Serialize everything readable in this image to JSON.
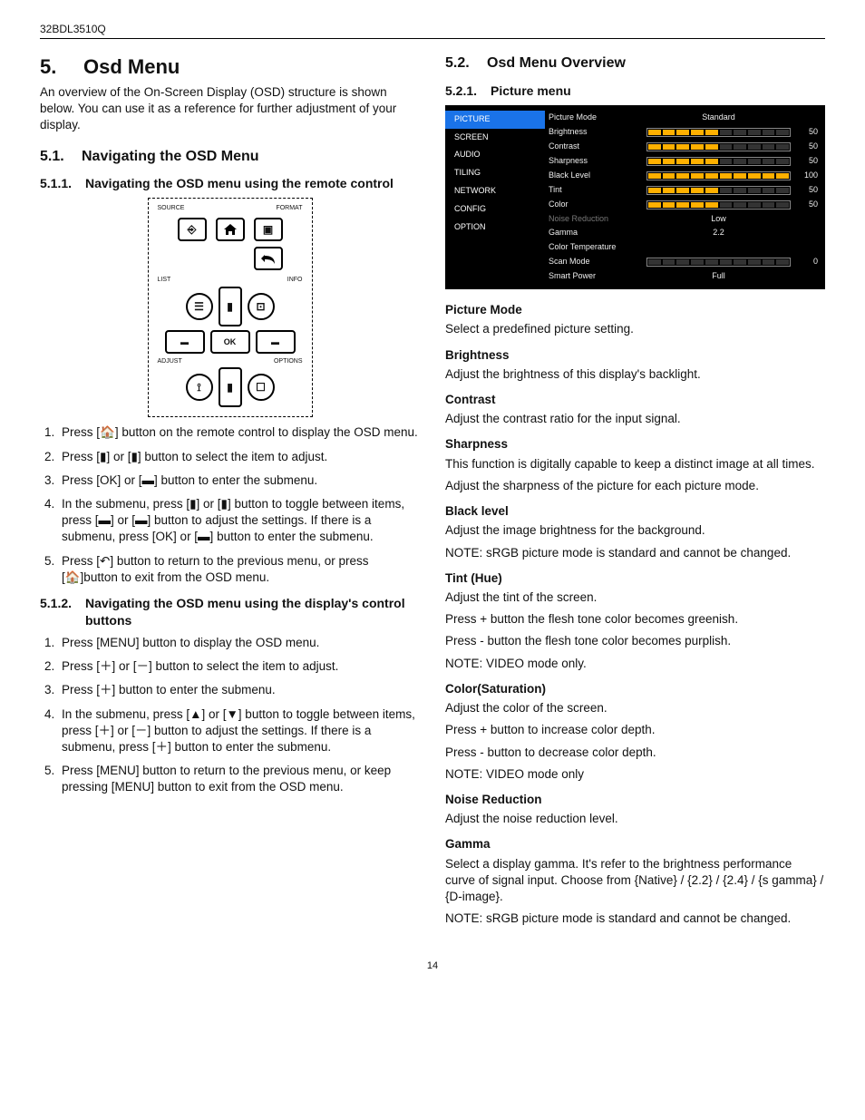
{
  "header": {
    "model": "32BDL3510Q"
  },
  "page_number": "14",
  "col1": {
    "h5_num": "5.",
    "h5_title": "Osd Menu",
    "intro": "An overview of the On-Screen Display (OSD) structure is shown below. You can use it as a reference for further adjustment of your display.",
    "h51_num": "5.1.",
    "h51_title": "Navigating the OSD Menu",
    "h511_num": "5.1.1.",
    "h511_title": "Navigating the OSD menu using the remote control",
    "remote_labels": {
      "source": "SOURCE",
      "format": "FORMAT",
      "list": "LIST",
      "info": "INFO",
      "adjust": "ADJUST",
      "options": "OPTIONS",
      "ok": "OK"
    },
    "steps_remote": [
      "Press [🏠] button on the remote control to display the OSD menu.",
      "Press [▮] or [▮] button to select the item to adjust.",
      "Press [OK] or [▬] button to enter the submenu.",
      "In the submenu, press [▮] or [▮] button to toggle between items, press [▬] or [▬] button to adjust the settings. If there is a submenu, press [OK] or [▬] button to enter the submenu.",
      "Press [↶] button to return to the previous menu, or press [🏠]button to exit from the OSD menu."
    ],
    "h512_num": "5.1.2.",
    "h512_title": "Navigating the OSD menu using the display's control buttons",
    "steps_display": [
      "Press [MENU] button to display the OSD menu.",
      "Press [＋] or [－] button to select the item to adjust.",
      "Press [＋] button to enter the submenu.",
      "In the submenu, press [▲] or [▼] button to toggle between items, press [＋] or [－] button to adjust the settings. If there is a submenu, press [＋] button to enter the submenu.",
      "Press [MENU] button to return to the previous menu, or keep pressing [MENU] button to exit from the OSD menu."
    ]
  },
  "col2": {
    "h52_num": "5.2.",
    "h52_title": "Osd Menu Overview",
    "h521_num": "5.2.1.",
    "h521_title": "Picture menu",
    "osd": {
      "nav": [
        "PICTURE",
        "SCREEN",
        "AUDIO",
        "TILING",
        "NETWORK",
        "CONFIG",
        "OPTION"
      ],
      "selected_index": 0,
      "rows": [
        {
          "label": "Picture Mode",
          "type": "text",
          "value": "Standard"
        },
        {
          "label": "Brightness",
          "type": "slider",
          "level": 5,
          "num": "50"
        },
        {
          "label": "Contrast",
          "type": "slider",
          "level": 5,
          "num": "50"
        },
        {
          "label": "Sharpness",
          "type": "slider",
          "level": 5,
          "num": "50"
        },
        {
          "label": "Black Level",
          "type": "slider",
          "level": 10,
          "num": "100"
        },
        {
          "label": "Tint",
          "type": "slider",
          "level": 5,
          "num": "50"
        },
        {
          "label": "Color",
          "type": "slider",
          "level": 5,
          "num": "50"
        },
        {
          "label": "Noise Reduction",
          "type": "text",
          "value": "Low",
          "dim": true
        },
        {
          "label": "Gamma",
          "type": "text",
          "value": "2.2"
        },
        {
          "label": "Color Temperature",
          "type": "text",
          "value": ""
        },
        {
          "label": "Scan Mode",
          "type": "slider",
          "level": 0,
          "num": "0"
        },
        {
          "label": "Smart Power",
          "type": "text",
          "value": "Full"
        }
      ]
    },
    "desc": [
      {
        "h": "Picture Mode",
        "p": [
          "Select a predefined picture setting."
        ]
      },
      {
        "h": "Brightness",
        "p": [
          "Adjust the brightness of this display's backlight."
        ]
      },
      {
        "h": "Contrast",
        "p": [
          " Adjust the contrast ratio for the input signal."
        ]
      },
      {
        "h": "Sharpness",
        "p": [
          "This function is digitally capable to keep a distinct image at all times.",
          "Adjust the sharpness of the picture for each picture mode."
        ]
      },
      {
        "h": "Black level",
        "p": [
          "Adjust the image brightness for the background.",
          "NOTE: sRGB picture mode is standard and cannot be changed."
        ]
      },
      {
        "h": "Tint (Hue)",
        "p": [
          "Adjust the tint of the screen.",
          "Press + button the flesh tone color becomes greenish.",
          "Press - button the flesh tone color becomes purplish.",
          "NOTE: VIDEO mode only."
        ]
      },
      {
        "h": "Color(Saturation)",
        "p": [
          "Adjust the color of the screen.",
          "Press + button to increase color depth.",
          "Press - button to decrease color depth.",
          "NOTE: VIDEO mode only"
        ]
      },
      {
        "h": "Noise Reduction",
        "p": [
          "Adjust the noise reduction level."
        ]
      },
      {
        "h": "Gamma",
        "p": [
          "Select a display gamma. It's refer to the brightness performance curve of signal input. Choose from {Native} / {2.2} / {2.4} / {s gamma} / {D-image}.",
          "NOTE: sRGB picture mode is standard and cannot be changed."
        ]
      }
    ]
  }
}
